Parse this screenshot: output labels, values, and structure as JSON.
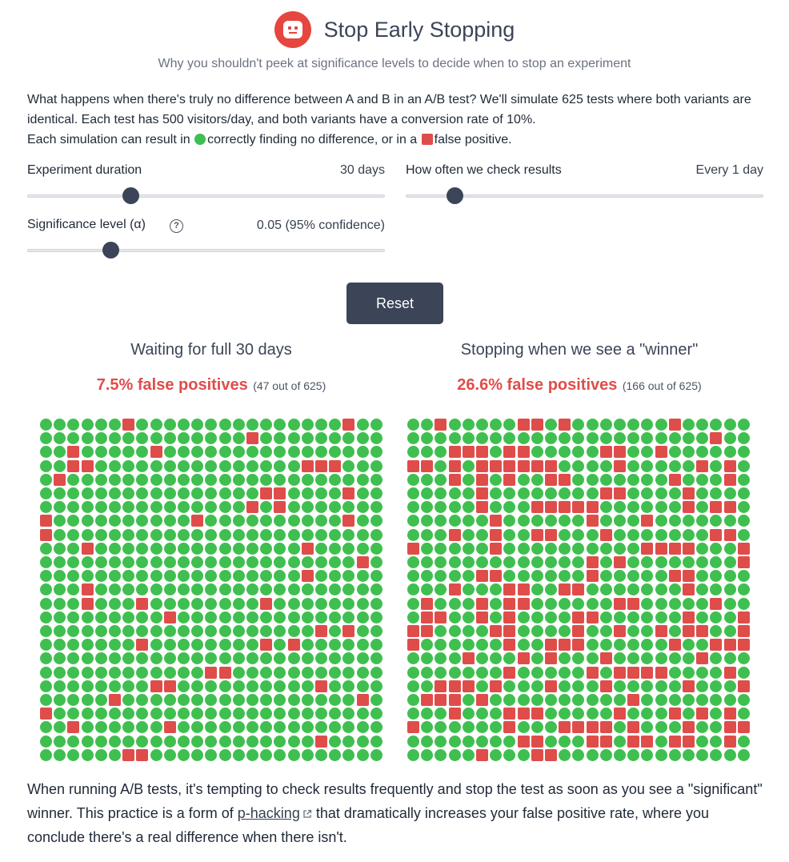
{
  "header": {
    "title": "Stop Early Stopping",
    "subtitle": "Why you shouldn't peek at significance levels to decide when to stop an experiment"
  },
  "intro": {
    "line1": "What happens when there's truly no difference between A and B in an A/B test? We'll simulate 625 tests where both variants are identical. Each test has 500 visitors/day, and both variants have a conversion rate of 10%.",
    "line2_prefix": "Each simulation can result in",
    "line2_correct": "correctly finding no difference, or in a",
    "line2_false": "false positive."
  },
  "controls": {
    "duration": {
      "label": "Experiment duration",
      "value": "30 days",
      "level": 0.28
    },
    "frequency": {
      "label": "How often we check results",
      "value": "Every 1 day",
      "level": 0.12
    },
    "significance": {
      "label": "Significance level (α)",
      "value": "0.05 (95% confidence)",
      "level": 0.22,
      "help_icon": "question-circle-icon"
    }
  },
  "reset_label": "Reset",
  "panels": {
    "left": {
      "title": "Waiting for full 30 days",
      "rate": "7.5% false positives",
      "count": "(47 out of 625)"
    },
    "right": {
      "title": "Stopping when we see a \"winner\"",
      "rate": "26.6% false positives",
      "count": "(166 out of 625)"
    }
  },
  "outro": {
    "text_before": "When running A/B tests, it's tempting to check results frequently and stop the test as soon as you see a \"significant\" winner. This practice is a form of ",
    "link": "p-hacking",
    "link_icon": "external-link-icon",
    "text_after": " that dramatically increases your false positive rate, where you conclude there's a real difference when there isn't."
  },
  "colors": {
    "correct": "#3fbf4f",
    "false_positive": "#df4d4a",
    "accent": "#3c4457"
  }
}
